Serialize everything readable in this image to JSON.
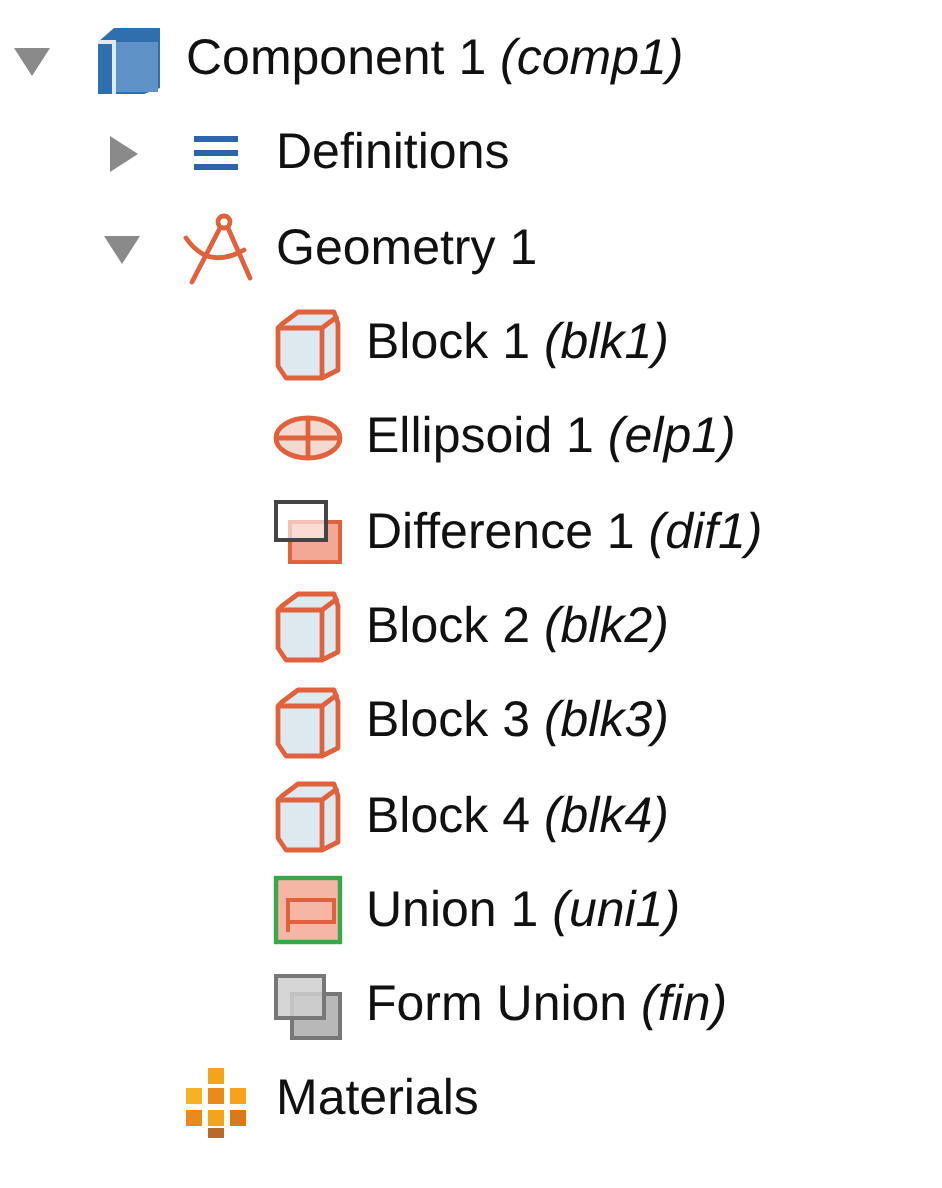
{
  "tree": [
    {
      "label": "Component 1 *(comp1)*",
      "kind": "component",
      "expanded": true,
      "children": [
        {
          "label": "Definitions",
          "kind": "definitions",
          "expanded": false
        },
        {
          "label": "Geometry 1",
          "kind": "geometry",
          "expanded": true,
          "children": [
            {
              "label": "Block 1 *(blk1)*",
              "kind": "block"
            },
            {
              "label": "Ellipsoid 1 *(elp1)*",
              "kind": "ellipsoid"
            },
            {
              "label": "Difference 1 *(dif1)*",
              "kind": "difference"
            },
            {
              "label": "Block 2 *(blk2)*",
              "kind": "block"
            },
            {
              "label": "Block 3 *(blk3)*",
              "kind": "block"
            },
            {
              "label": "Block 4 *(blk4)*",
              "kind": "block"
            },
            {
              "label": "Union 1 *(uni1)*",
              "kind": "union"
            },
            {
              "label": "Form Union *(fin)*",
              "kind": "form_union"
            }
          ]
        },
        {
          "label": "Materials",
          "kind": "materials"
        }
      ]
    }
  ]
}
